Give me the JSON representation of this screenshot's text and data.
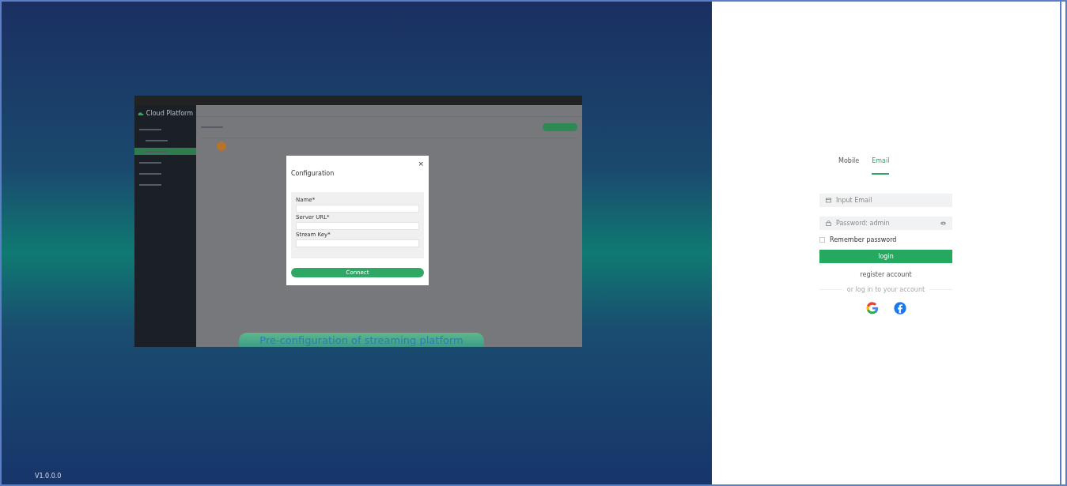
{
  "preview": {
    "brand": "Cloud Platform",
    "menu": [
      {
        "selected": false
      },
      {
        "selected": false
      },
      {
        "selected": true
      },
      {
        "selected": false
      },
      {
        "selected": false
      },
      {
        "selected": false
      }
    ],
    "modal": {
      "title": "Configuration",
      "close": "×",
      "fields": [
        {
          "label": "Name*"
        },
        {
          "label": "Server URL*"
        },
        {
          "label": "Stream Key*"
        }
      ],
      "button": "Connect"
    },
    "caption": "Pre-configuration of streaming platform"
  },
  "version": "V1.0.0.0",
  "login": {
    "tabs": [
      {
        "label": "Mobile",
        "selected": false
      },
      {
        "label": "Email",
        "selected": true
      }
    ],
    "email": {
      "placeholder": "Input Email"
    },
    "password": {
      "placeholder": "Password: admin"
    },
    "remember": {
      "label": "Remember password",
      "checked": false
    },
    "button": "login",
    "register": "register account",
    "divider": "or log in to your account"
  }
}
